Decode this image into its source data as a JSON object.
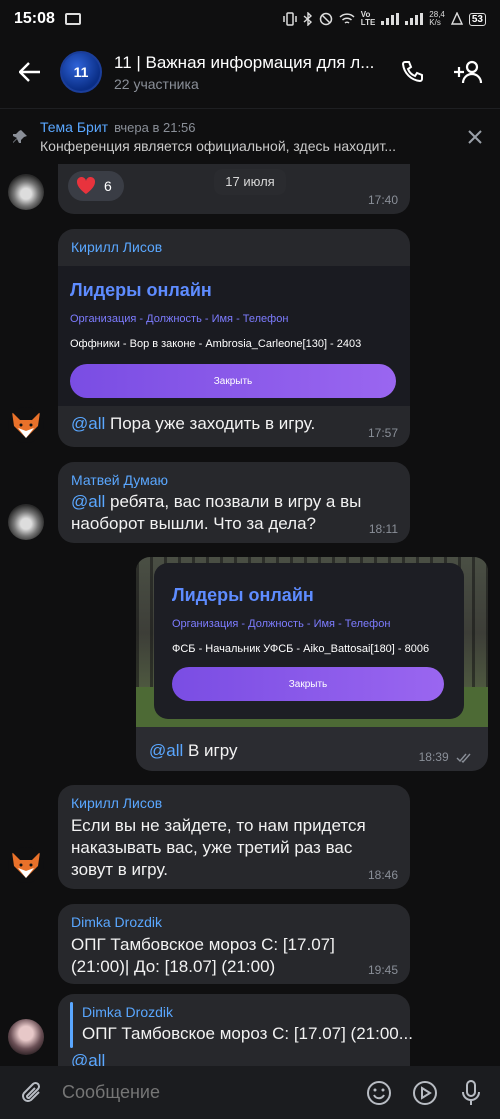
{
  "status_bar": {
    "time": "15:08",
    "network_speed": "28,4\nK/s",
    "battery": "53"
  },
  "header": {
    "avatar_text": "11",
    "title": "11 | Важная информация для л...",
    "subtitle": "22 участника"
  },
  "pinned": {
    "author": "Тема Брит",
    "time": "вчера в 21:56",
    "text": "Конференция является официальной, здесь находит..."
  },
  "messages": {
    "m0": {
      "reaction_count": "6",
      "date_chip": "17 июля",
      "time": "17:40"
    },
    "m1": {
      "author": "Кирилл Лисов",
      "card": {
        "title": "Лидеры онлайн",
        "subtitle": "Организация - Должность - Имя - Телефон",
        "row": "Оффники - Вор в законе - Ambrosia_Carleone[130] - 2403",
        "button": "Закрыть"
      },
      "mention": "@all",
      "text": " Пора  уже заходить в игру.",
      "time": "17:57"
    },
    "m2": {
      "author": "Матвей Думаю",
      "mention": "@all",
      "text": " ребята, вас позвали в игру а вы наоборот вышли. Что за дела?",
      "time": "18:11"
    },
    "m3": {
      "card": {
        "title": "Лидеры онлайн",
        "subtitle": "Организация - Должность - Имя - Телефон",
        "row": "ФСБ - Начальник УФСБ - Aiko_Battosai[180] - 8006",
        "button": "Закрыть"
      },
      "mention": "@all",
      "text": " В игру",
      "time": "18:39"
    },
    "m4": {
      "author": "Кирилл Лисов",
      "text": "Если вы не зайдете, то нам придется наказывать вас, уже третий раз вас зовут в игру.",
      "time": "18:46"
    },
    "m5": {
      "author": "Dimka Drozdik",
      "text": "ОПГ Тамбовское мороз С: [17.07] (21:00)| До: [18.07] (21:00)",
      "time": "19:45"
    },
    "m6": {
      "reply_author": "Dimka Drozdik",
      "reply_text": "ОПГ Тамбовское мороз С: [17.07] (21:00...",
      "mention": "@all"
    }
  },
  "input": {
    "placeholder": "Сообщение"
  }
}
